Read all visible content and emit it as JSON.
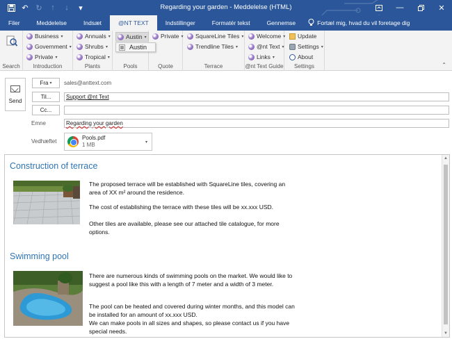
{
  "window": {
    "title": "Regarding your garden - Meddelelse (HTML)"
  },
  "tabs": [
    {
      "label": "Filer"
    },
    {
      "label": "Meddelelse"
    },
    {
      "label": "Indsæt"
    },
    {
      "label": "@NT TEXT"
    },
    {
      "label": "Indstillinger"
    },
    {
      "label": "Formatér tekst"
    },
    {
      "label": "Gennemse"
    }
  ],
  "tell_me": "Fortæl mig, hvad du vil foretage dig",
  "ribbon": {
    "groups": {
      "search": "Search",
      "introduction": "Introduction",
      "plants": "Plants",
      "pools": "Pools",
      "quote": "Quote",
      "terrace": "Terrace",
      "nt_text_guide": "@nt Text Guide",
      "settings": "Settings"
    },
    "intro": [
      "Business",
      "Government",
      "Private"
    ],
    "plants": [
      "Annuals",
      "Shrubs",
      "Tropical"
    ],
    "pools": [
      "Austin"
    ],
    "quote": [
      "Private"
    ],
    "terrace": [
      "SquareLine Tiles",
      "Trendline Tiles"
    ],
    "guide": [
      "Welcome",
      "@nt Text",
      "Links"
    ],
    "settings": [
      "Update",
      "Settings",
      "About"
    ],
    "dropdown_item": "Austin"
  },
  "compose": {
    "send": "Send",
    "from_btn": "Fra",
    "from_addr": "sales@anttext.com",
    "to_btn": "Til...",
    "to_value": "Support @nt Text",
    "cc_btn": "Cc...",
    "cc_value": "",
    "subject_label": "Emne",
    "subject_value": "Regarding your garden",
    "attached_label": "Vedhæftet",
    "attachment_name": "Pools.pdf",
    "attachment_size": "1 MB"
  },
  "body": {
    "heading1": "Construction of terrace",
    "p1": "The proposed terrace will be established with SquareLine tiles, covering an area of XX m² around the residence.",
    "p2": "The cost of establishing the terrace with these tiles will be xx.xxx USD.",
    "p3": "Other tiles are available, please see our attached tile catalogue, for more options.",
    "heading2": "Swimming pool",
    "p4": "There are numerous kinds of swimming pools on the market. We would like to suggest a pool like this with a length of 7 meter and a width of 3 meter.",
    "p5": "The pool can be heated and covered during winter months, and this model can be installed for an amount of xx.xxx USD.",
    "p6": "We can make pools in all sizes and shapes, so please contact us if you have special needs."
  },
  "colors": {
    "brand": "#2b579a",
    "heading": "#2e74b5"
  }
}
